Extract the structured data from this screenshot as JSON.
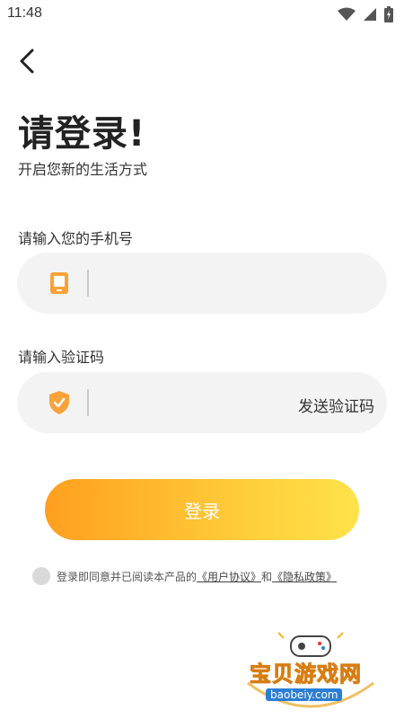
{
  "status_bar": {
    "time": "11:48",
    "icons": [
      "wifi-icon",
      "signal-icon",
      "battery-icon"
    ]
  },
  "back_icon": "chevron-left-icon",
  "title": "请登录!",
  "subtitle": "开启您新的生活方式",
  "phone": {
    "label": "请输入您的手机号",
    "value": "",
    "placeholder": "",
    "icon": "phone-icon"
  },
  "code": {
    "label": "请输入验证码",
    "value": "",
    "placeholder": "",
    "icon": "shield-check-icon",
    "send_label": "发送验证码"
  },
  "login_label": "登录",
  "agreement": {
    "prefix": "登录即同意并已阅读本产品的",
    "user_agreement": "《用户协议》",
    "and": "和",
    "privacy_policy": "《隐私政策》"
  },
  "watermark": {
    "text": "宝贝游戏网",
    "url": "baobeiy.com"
  },
  "colors": {
    "accent_start": "#ff9f1f",
    "accent_end": "#ffe24a",
    "icon_orange": "#f9a23a",
    "field_bg": "#f3f3f3"
  }
}
